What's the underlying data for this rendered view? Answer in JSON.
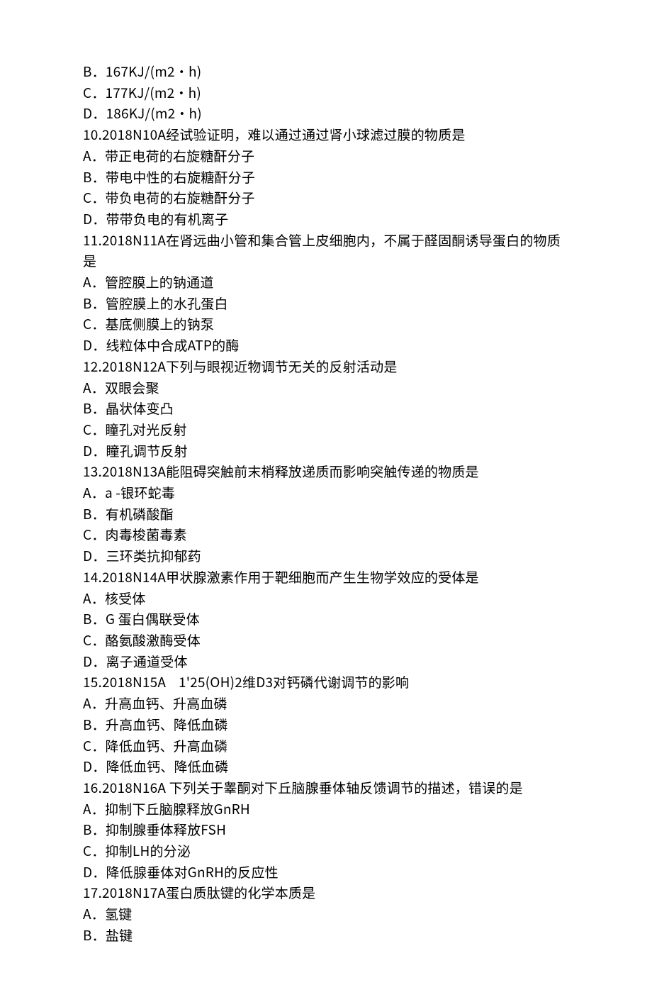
{
  "lines": [
    "B．167KJ/(m2·h)",
    "C．177KJ/(m2·h)",
    "D．186KJ/(m2·h)",
    "10.2018N10A经试验证明，难以通过通过肾小球滤过膜的物质是",
    "A．带正电荷的右旋糖酐分子",
    "B．带电中性的右旋糖酐分子",
    "C．带负电荷的右旋糖酐分子",
    "D．带带负电的有机离子",
    "11.2018N11A在肾远曲小管和集合管上皮细胞内，不属于醛固酮诱导蛋白的物质是",
    "A．管腔膜上的钠通道",
    "B．管腔膜上的水孔蛋白",
    "C．基底侧膜上的钠泵",
    "D．线粒体中合成ATP的酶",
    "12.2018N12A下列与眼视近物调节无关的反射活动是",
    "A．双眼会聚",
    "B．晶状体变凸",
    "C．瞳孔对光反射",
    "D．瞳孔调节反射",
    "13.2018N13A能阻碍突触前末梢释放递质而影响突触传递的物质是",
    "A．a -银环蛇毒",
    "B．有机磷酸酯",
    "C．肉毒梭菌毒素",
    "D．三环类抗抑郁药",
    "14.2018N14A甲状腺激素作用于靶细胞而产生生物学效应的受体是",
    "A．核受体",
    "B．G 蛋白偶联受体",
    "C．酪氨酸激酶受体",
    "D．离子通道受体",
    "15.2018N15A    1'25(OH)2维D3对钙磷代谢调节的影响",
    "A．升高血钙、升高血磷",
    "B．升高血钙、降低血磷",
    "C．降低血钙、升高血磷",
    "D．降低血钙、降低血磷",
    "16.2018N16A 下列关于睾酮对下丘脑腺垂体轴反馈调节的描述，错误的是",
    "A．抑制下丘脑腺释放GnRH",
    "B．抑制腺垂体释放FSH",
    "C．抑制LH的分泌",
    "D．降低腺垂体对GnRH的反应性",
    "17.2018N17A蛋白质肽键的化学本质是",
    "A．氢键",
    "B．盐键"
  ]
}
